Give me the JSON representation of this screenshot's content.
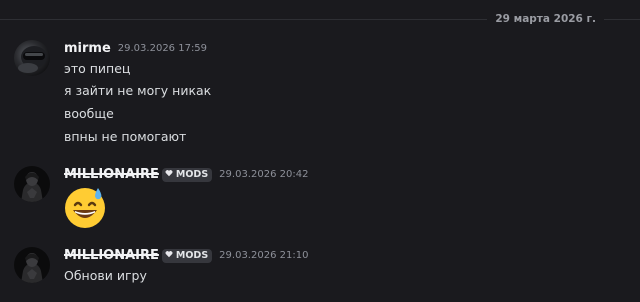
{
  "date_divider": "29 марта 2026 г.",
  "messages": [
    {
      "author": "mirme",
      "timestamp": "29.03.2026 17:59",
      "lines": [
        "это пипец",
        "я зайти не могу никак",
        "вообще",
        "впны не помогают"
      ]
    },
    {
      "author": "MILLIONAIRE",
      "role_tag": "MODS",
      "timestamp": "29.03.2026 20:42",
      "emoji": "grinning-face-with-sweat"
    },
    {
      "author": "MILLIONAIRE",
      "role_tag": "MODS",
      "timestamp": "29.03.2026 21:10",
      "lines": [
        "Обнови игру"
      ]
    }
  ],
  "colors": {
    "background": "#1a1a1e",
    "username": "#f2f3f5",
    "message_text": "#dbdee1",
    "timestamp": "#8d9099",
    "tag_background": "#36373d"
  }
}
